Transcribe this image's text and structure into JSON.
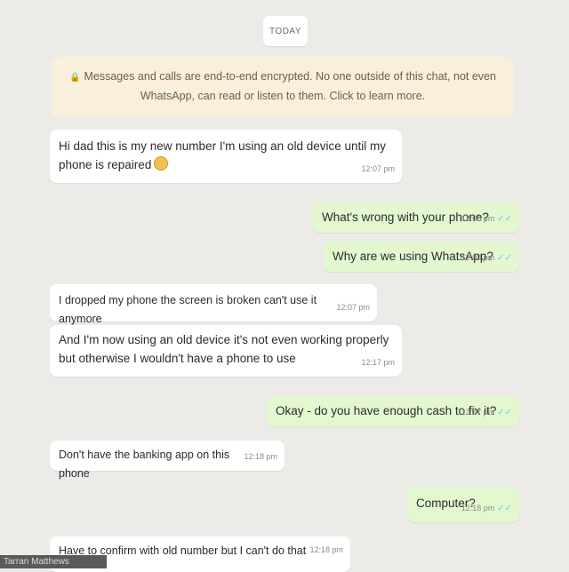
{
  "date_chip": "TODAY",
  "e2e_notice": {
    "icon": "lock-icon",
    "text": "Messages and calls are end-to-end encrypted. No one outside of this chat, not even WhatsApp, can read or listen to them. Click to learn more."
  },
  "messages": [
    {
      "direction": "in",
      "text": "Hi dad this is my new number I'm using an old device until my phone is repaired",
      "emoji": "grimace-face-emoji",
      "time": "12:07 pm"
    },
    {
      "direction": "out",
      "text": "What's wrong with your phone?",
      "time": "12:08 pm",
      "status": "read"
    },
    {
      "direction": "out",
      "text": "Why are we using WhatsApp?",
      "time": "12:08 pm",
      "status": "read"
    },
    {
      "direction": "in",
      "text": "I dropped my phone the screen is broken can't use it anymore",
      "time": "12:07 pm"
    },
    {
      "direction": "in",
      "text": "And I'm now using an old device it's not even working properly but otherwise I wouldn't have a phone to use",
      "time": "12:17 pm"
    },
    {
      "direction": "out",
      "text": "Okay - do you have enough cash to fix it?",
      "time": "12:17 pm",
      "status": "read"
    },
    {
      "direction": "in",
      "text": "Don't have the banking app on this phone",
      "time": "12:18 pm"
    },
    {
      "direction": "out",
      "text": "Computer?",
      "time": "12:18 pm",
      "status": "read"
    },
    {
      "direction": "in",
      "text": "Have to confirm with old number but I can't do that now",
      "time": "12:18 pm"
    }
  ],
  "watermark": "Tarran Matthews",
  "colors": {
    "background": "#ecebe8",
    "incoming_bubble": "#ffffff",
    "outgoing_bubble": "#e3f8cf",
    "notice_bg": "#f8efdd",
    "read_tick": "#7cc4e8"
  }
}
